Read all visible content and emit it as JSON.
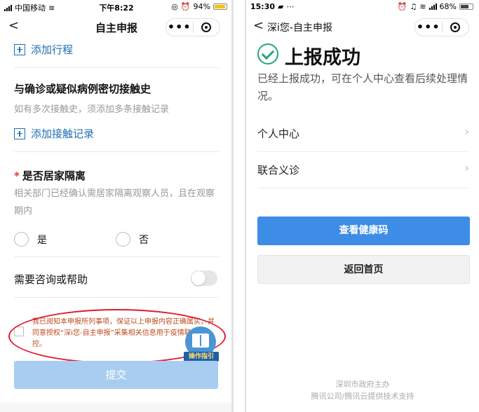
{
  "left": {
    "status": {
      "carrier": "中国移动",
      "time": "下午8:22",
      "battery": "94%"
    },
    "nav": {
      "title": "自主申报",
      "back": "<"
    },
    "add_trip": "添加行程",
    "contact_heading": "与确诊或疑似病例密切接触史",
    "contact_hint": "如有多次接触史，须添加多条接触记录",
    "add_contact": "添加接触记录",
    "quarantine_heading": "是否居家隔离",
    "quarantine_required_mark": "*",
    "quarantine_hint": "相关部门已经确认需居家隔离观察人员，且在观察期内",
    "options": {
      "yes": "是",
      "no": "否"
    },
    "help_label": "需要咨询或帮助",
    "consent_text": "我已阅知本申报所列事项，保证以上申报内容正确属实，并同意授权“深i您-自主申报”采集相关信息用于疫情联防联控。",
    "guide_label": "操作指引",
    "submit_label": "提交"
  },
  "right": {
    "status": {
      "time": "15:30",
      "battery": "68%"
    },
    "nav": {
      "title": "深i您-自主申报",
      "back": "<"
    },
    "success_title": "上报成功",
    "success_desc": "已经上报成功，可在个人中心查看后续处理情况。",
    "menu": [
      {
        "label": "个人中心"
      },
      {
        "label": "联合义诊"
      }
    ],
    "primary_button": "查看健康码",
    "secondary_button": "返回首页",
    "footer_line1": "深圳市政府主办",
    "footer_line2": "腾讯公司/腾讯云提供技术支持"
  },
  "colors": {
    "link_blue": "#1e6fb5",
    "success_green": "#25a67a",
    "primary_blue": "#3d8de6",
    "submit_disabled": "#a9cdf0",
    "annotation_red": "#e3192c"
  },
  "icons": [
    "plus-square-icon",
    "chevron-right-icon",
    "check-circle-icon",
    "record-icon",
    "more-icon",
    "book-icon"
  ]
}
